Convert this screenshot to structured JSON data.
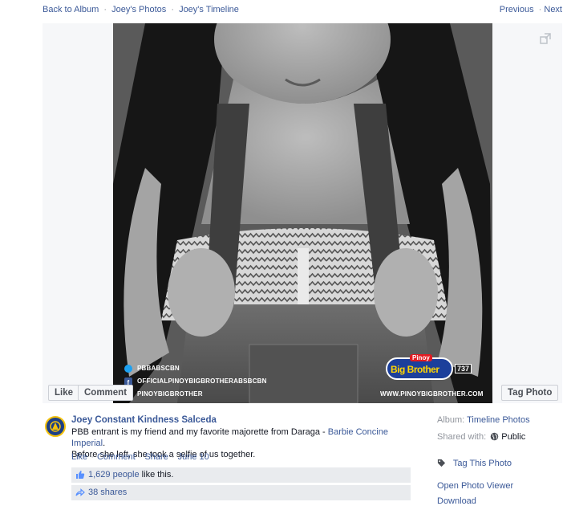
{
  "topnav": {
    "back_to_album": "Back to Album",
    "photos": "Joey's Photos",
    "timeline": "Joey's Timeline",
    "previous": "Previous",
    "next": "Next",
    "separator": "·"
  },
  "photo": {
    "like_button": "Like",
    "comment_button": "Comment",
    "tag_button": "Tag Photo",
    "watermark_twitter": "PBBABSCBN",
    "watermark_facebook": "OFFICIALPINOYBIGBROTHERABSBCBN",
    "watermark_instagram": "PINOYBIGBROTHER",
    "watermark_url": "WWW.PINOYBIGBROTHER.COM",
    "logo_text_top": "Pinoy",
    "logo_text_main": "Big Brother",
    "logo_badge": "737"
  },
  "post": {
    "author": "Joey Constant Kindness Salceda",
    "caption_part1": "PBB entrant is my friend and my favorite majorette from Daraga - ",
    "caption_link": "Barbie Concine Imperial",
    "caption_part2": ".",
    "caption_line2": "Before she left, she took a selfie of us together.",
    "action_like": "Like",
    "action_comment": "Comment",
    "action_share": "Share",
    "date": "June 10",
    "dot": "·",
    "likes_count": "1,629 people",
    "likes_suffix": " like this.",
    "shares": "38 shares"
  },
  "sidebar": {
    "album_label": "Album:",
    "album_value": "Timeline Photos",
    "shared_label": "Shared with:",
    "shared_value": "Public",
    "tag_this_photo": "Tag This Photo",
    "open_viewer": "Open Photo Viewer",
    "download": "Download"
  },
  "colors": {
    "link": "#3b5998",
    "muted": "#90949c",
    "ufi_bg": "#e9ebee"
  },
  "icons": {
    "expand": "expand-icon",
    "like": "thumbs-up-icon",
    "share": "share-arrow-icon",
    "globe": "globe-icon",
    "tag": "tag-icon",
    "twitter": "twitter-icon",
    "facebook": "facebook-icon"
  }
}
